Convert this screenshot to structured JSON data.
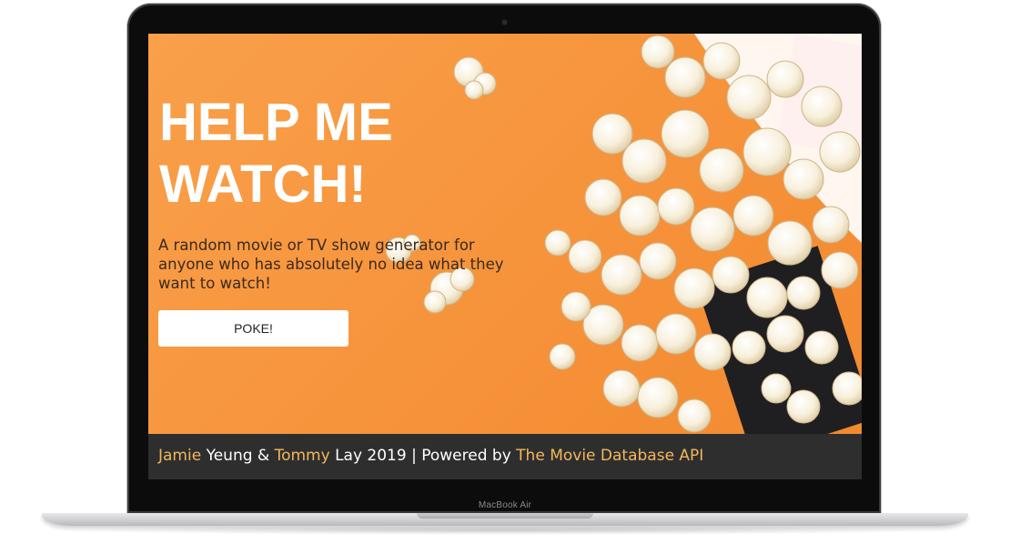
{
  "hero": {
    "title_line1": "HELP ME",
    "title_line2": "WATCH!",
    "tagline": "A random movie or TV show generator for anyone who has absolutely no idea what they want to watch!",
    "button_label": "POKE!"
  },
  "footer": {
    "author1_first": "Jamie",
    "author1_last": " Yeung & ",
    "author2_first": "Tommy",
    "author2_last": " Lay 2019 | Powered by ",
    "api_link": "The Movie Database API"
  },
  "device": {
    "label": "MacBook Air"
  },
  "colors": {
    "background": "#f7963a",
    "accent": "#f4b75a",
    "footer_bg": "#2e2e2e",
    "popcorn": "#fbf3df"
  }
}
